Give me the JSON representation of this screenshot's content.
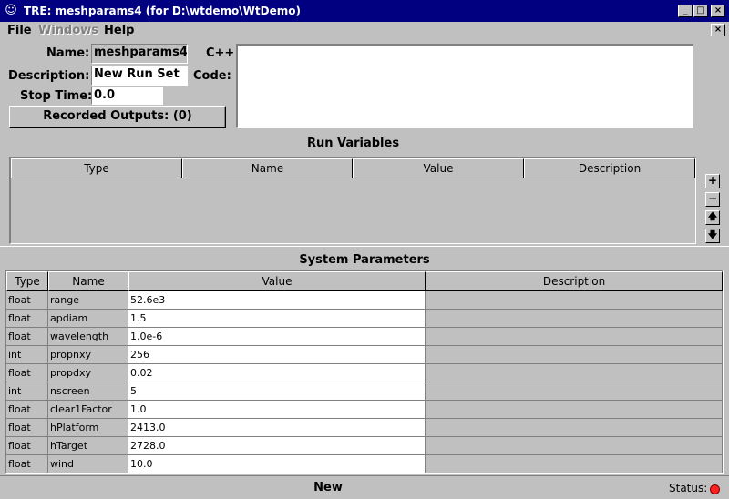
{
  "window": {
    "title": "TRE:  meshparams4  (for D:\\wtdemo\\WtDemo)",
    "minimize": "_",
    "maximize": "□",
    "close": "×"
  },
  "menu": {
    "file": "File",
    "windows": "Windows",
    "help": "Help",
    "close": "×"
  },
  "form": {
    "name_label": "Name:",
    "name_value": "meshparams4",
    "description_label": "Description:",
    "description_value": "New Run Set",
    "stop_time_label": "Stop Time:",
    "stop_time_value": "0.0",
    "cpp_label": "C++",
    "code_label": "Code:",
    "recorded_outputs": "Recorded Outputs: (0)"
  },
  "run_variables": {
    "title": "Run Variables",
    "columns": [
      "Type",
      "Name",
      "Value",
      "Description"
    ],
    "buttons": {
      "add": "+",
      "remove": "−",
      "up": "🡅",
      "down": "🡇"
    }
  },
  "system_parameters": {
    "title": "System Parameters",
    "columns": [
      "Type",
      "Name",
      "Value",
      "Description"
    ],
    "rows": [
      {
        "type": "float",
        "name": "range",
        "value": "52.6e3",
        "description": ""
      },
      {
        "type": "float",
        "name": "apdiam",
        "value": "1.5",
        "description": ""
      },
      {
        "type": "float",
        "name": "wavelength",
        "value": "1.0e-6",
        "description": ""
      },
      {
        "type": "int",
        "name": "propnxy",
        "value": "256",
        "description": ""
      },
      {
        "type": "float",
        "name": "propdxy",
        "value": "0.02",
        "description": ""
      },
      {
        "type": "int",
        "name": "nscreen",
        "value": "5",
        "description": ""
      },
      {
        "type": "float",
        "name": "clear1Factor",
        "value": "1.0",
        "description": ""
      },
      {
        "type": "float",
        "name": "hPlatform",
        "value": "2413.0",
        "description": ""
      },
      {
        "type": "float",
        "name": "hTarget",
        "value": "2728.0",
        "description": ""
      },
      {
        "type": "float",
        "name": "wind",
        "value": "10.0",
        "description": ""
      }
    ]
  },
  "status": {
    "text": "New",
    "label": "Status:",
    "indicator_color": "#ff2020"
  },
  "colors": {
    "titlebar": "#000080",
    "face": "#c0c0c0"
  }
}
